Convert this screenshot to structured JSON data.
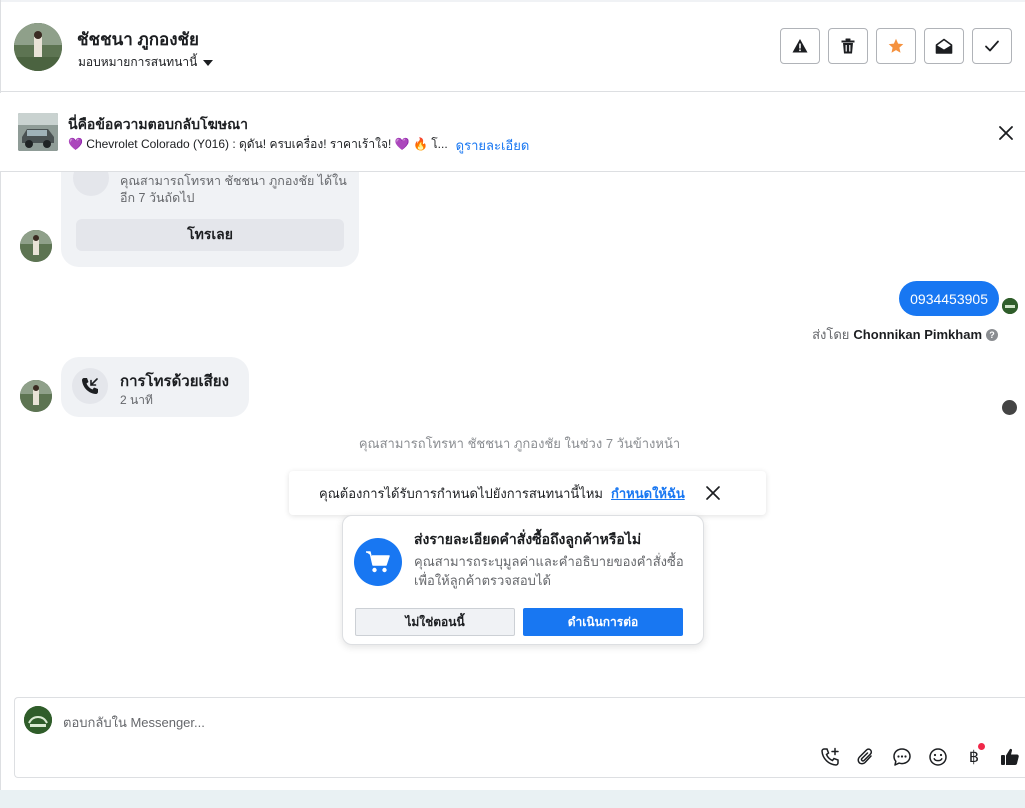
{
  "header": {
    "contact_name": "ชัชชนา ภูกองชัย",
    "assign_label": "มอบหมายการสนทนานี้",
    "actions": [
      "report-icon",
      "delete-icon",
      "star-icon",
      "mark-unread-icon",
      "done-icon"
    ],
    "star_color": "#f5913e"
  },
  "ad_banner": {
    "title": "นี่คือข้อความตอบกลับโฆษณา",
    "description": "💜 Chevrolet Colorado (Y016) : ดุดัน! ครบเครื่อง! ราคาเร้าใจ! 💜 🔥 โ...",
    "details_link": "ดูรายละเอียด"
  },
  "messages": {
    "call_card": {
      "text": "คุณสามารถโทรหา ชัชชนา ภูกองชัย ได้ใน อีก 7 วันถัดไป",
      "button": "โทรเลย"
    },
    "outgoing": {
      "text": "0934453905",
      "sent_by_prefix": "ส่งโดย",
      "sent_by_name": "Chonnikan Pimkham",
      "help": "?"
    },
    "voice_call": {
      "title": "การโทรด้วยเสียง",
      "duration": "2 นาที"
    },
    "system_note": "คุณสามารถโทรหา ชัชชนา ภูกองชัย ในช่วง 7 วันข้างหน้า"
  },
  "assign_prompt": {
    "text": "คุณต้องการได้รับการกำหนดไปยังการสนทนานี้ไหม",
    "link": "กำหนดให้ฉัน"
  },
  "order_prompt": {
    "title": "ส่งรายละเอียดคำสั่งซื้อถึงลูกค้าหรือไม่",
    "description": "คุณสามารถระบุมูลค่าและคำอธิบายของคำสั่งซื้อเพื่อให้ลูกค้าตรวจสอบได้",
    "decline": "ไม่ใช่ตอนนี้",
    "accept": "ดำเนินการต่อ"
  },
  "composer": {
    "placeholder": "ตอบกลับใน Messenger...",
    "tools": [
      "add-call-icon",
      "attach-icon",
      "saved-reply-icon",
      "emoji-icon",
      "baht-icon",
      "like-icon"
    ],
    "currency_glyph": "฿"
  },
  "colors": {
    "accent": "#1877f2",
    "bubble_gray": "#f0f2f5"
  }
}
